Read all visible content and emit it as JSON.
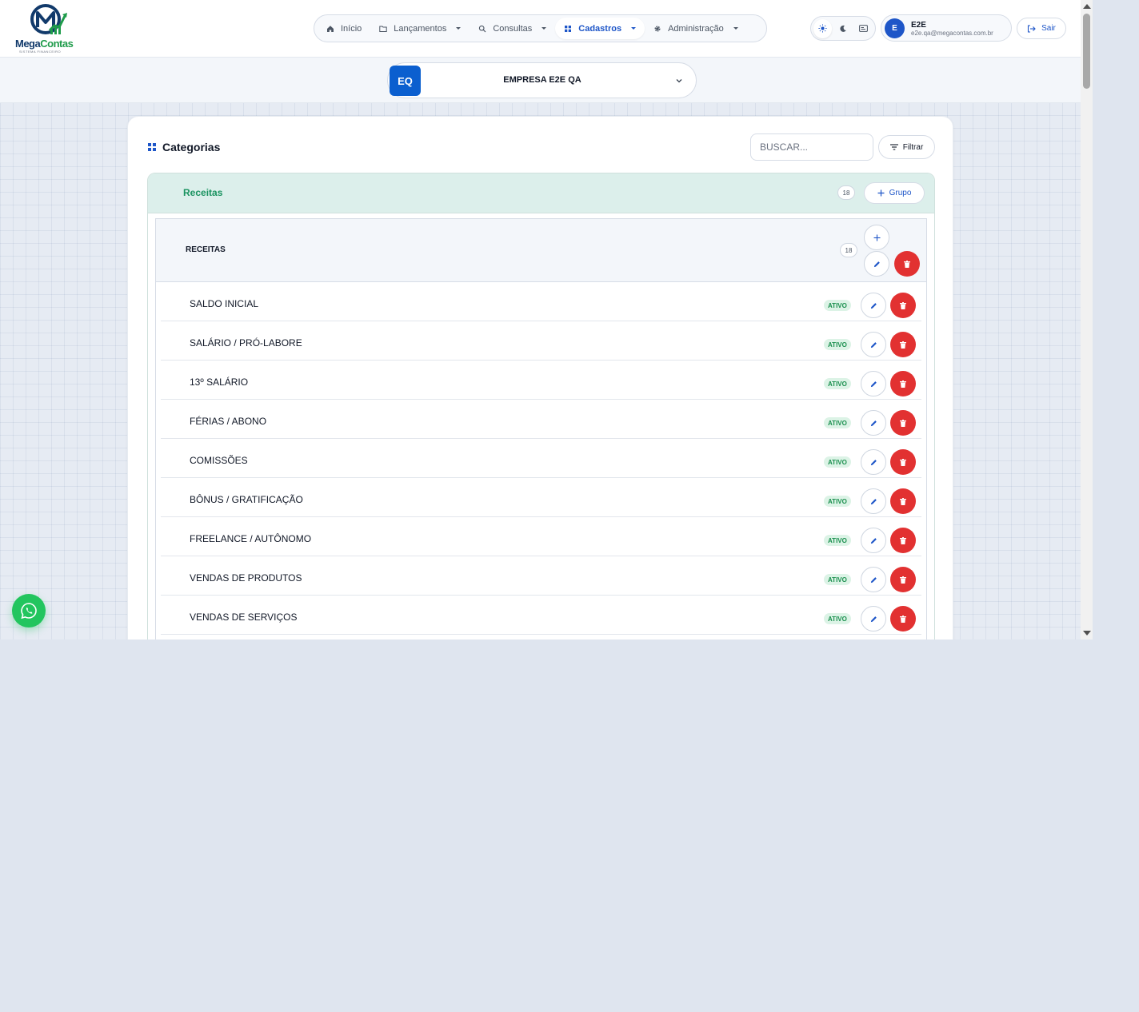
{
  "brand": {
    "name_part1": "Mega",
    "name_part2": "Contas",
    "tagline": "SISTEMA FINANCEIRO"
  },
  "nav": {
    "items": [
      {
        "label": "Início",
        "icon": "home-icon",
        "has_dropdown": false,
        "active": false
      },
      {
        "label": "Lançamentos",
        "icon": "folder-icon",
        "has_dropdown": true,
        "active": false
      },
      {
        "label": "Consultas",
        "icon": "search-icon",
        "has_dropdown": true,
        "active": false
      },
      {
        "label": "Cadastros",
        "icon": "grid-icon",
        "has_dropdown": true,
        "active": true
      },
      {
        "label": "Administração",
        "icon": "gear-icon",
        "has_dropdown": true,
        "active": false
      }
    ]
  },
  "theme": {
    "options": [
      "sun-icon",
      "moon-icon",
      "card-icon"
    ],
    "active": "sun-icon"
  },
  "user": {
    "initial": "E",
    "name": "E2E",
    "email": "e2e.qa@megacontas.com.br"
  },
  "logout_label": "Sair",
  "company": {
    "badge": "EQ",
    "name": "EMPRESA E2E QA"
  },
  "page": {
    "title": "Categorias",
    "search_placeholder": "BUSCAR...",
    "filter_label": "Filtrar"
  },
  "section": {
    "title": "Receitas",
    "count": "18",
    "add_group_label": "Grupo",
    "group": {
      "title": "RECEITAS",
      "count": "18",
      "items": [
        {
          "label": "SALDO INICIAL",
          "status": "ATIVO"
        },
        {
          "label": "SALÁRIO / PRÓ-LABORE",
          "status": "ATIVO"
        },
        {
          "label": "13º SALÁRIO",
          "status": "ATIVO"
        },
        {
          "label": "FÉRIAS / ABONO",
          "status": "ATIVO"
        },
        {
          "label": "COMISSÕES",
          "status": "ATIVO"
        },
        {
          "label": "BÔNUS / GRATIFICAÇÃO",
          "status": "ATIVO"
        },
        {
          "label": "FREELANCE / AUTÔNOMO",
          "status": "ATIVO"
        },
        {
          "label": "VENDAS DE PRODUTOS",
          "status": "ATIVO"
        },
        {
          "label": "VENDAS DE SERVIÇOS",
          "status": "ATIVO"
        }
      ]
    }
  },
  "colors": {
    "primary": "#1e56c8",
    "success": "#1a9360",
    "danger": "#e23131",
    "whatsapp": "#22c55e"
  }
}
